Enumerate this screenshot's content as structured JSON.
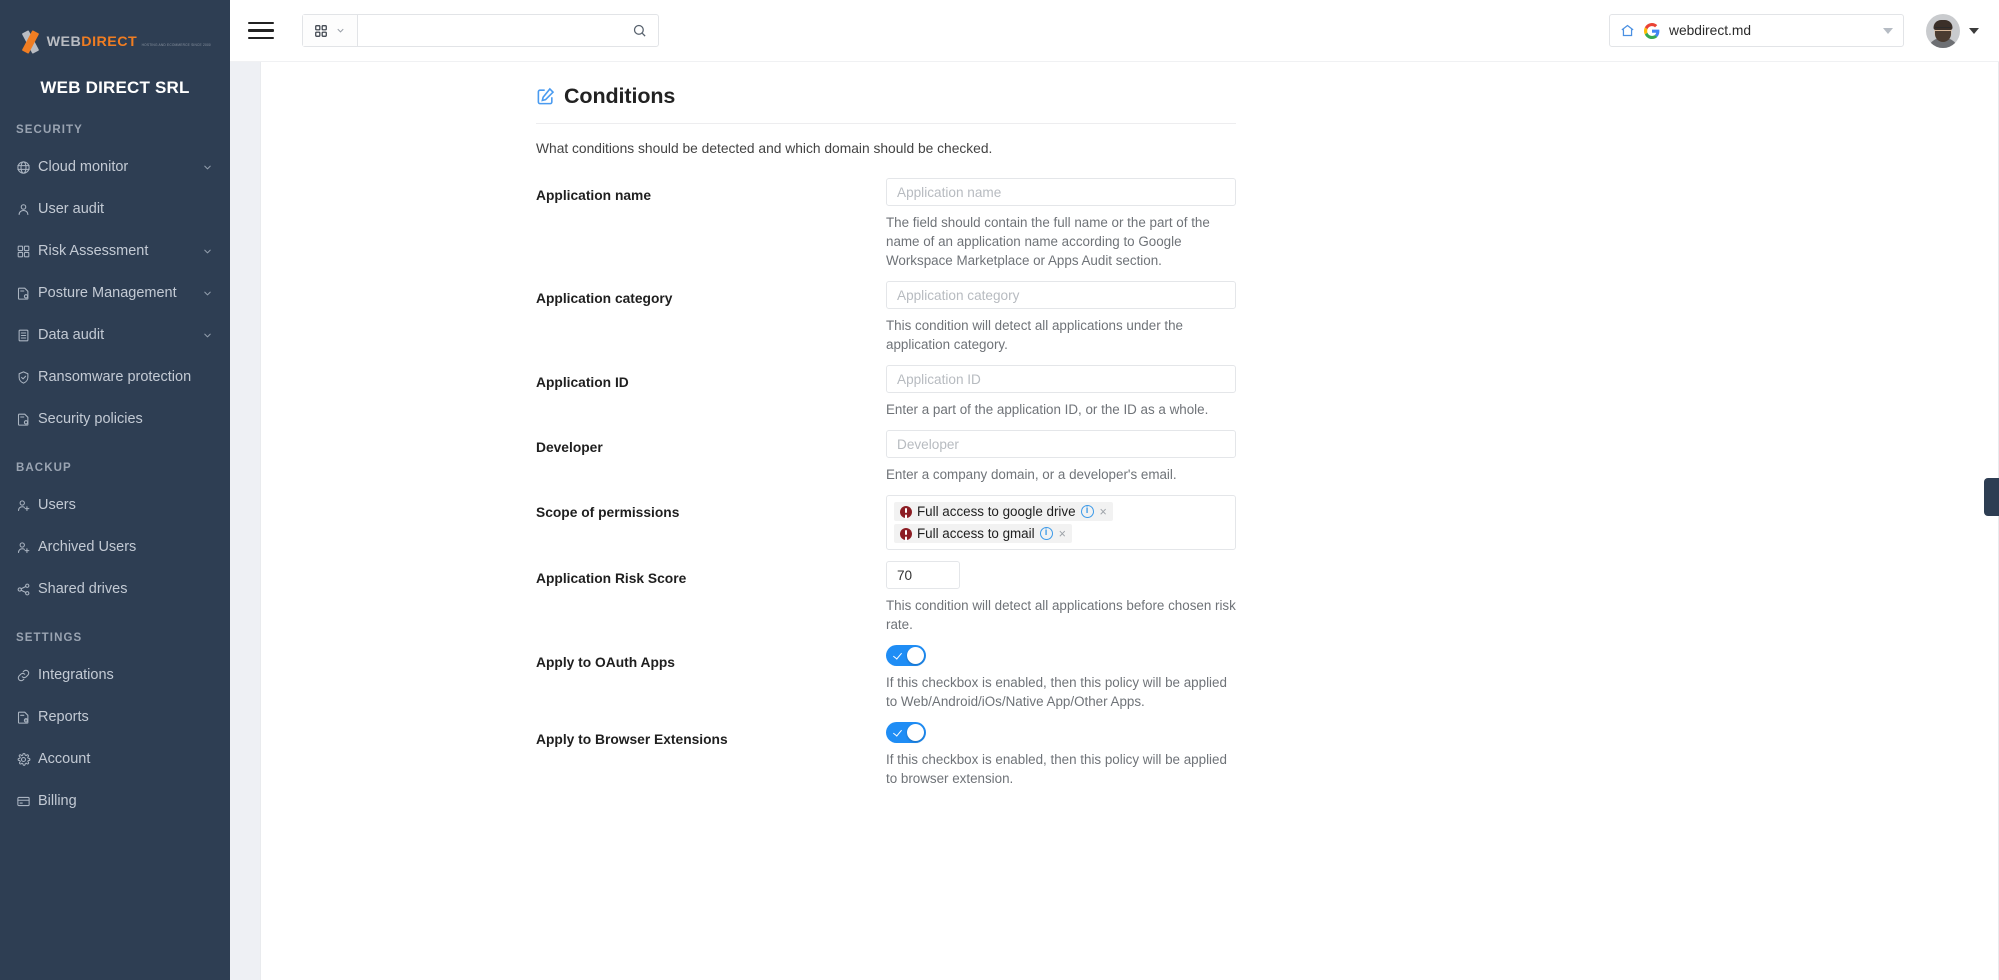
{
  "brand": {
    "logo_word_1": "WEB",
    "logo_word_2": "DIRECT",
    "logo_tagline": "HOSTING AND ECOMMERCE SINCE 2000",
    "org_name": "WEB DIRECT SRL"
  },
  "sidebar": {
    "groups": [
      {
        "title": "SECURITY",
        "items": [
          {
            "label": "Cloud monitor",
            "icon": "globe-icon",
            "chevron": true
          },
          {
            "label": "User audit",
            "icon": "user-icon",
            "chevron": false
          },
          {
            "label": "Risk Assessment",
            "icon": "grid-icon",
            "chevron": true
          },
          {
            "label": "Posture Management",
            "icon": "document-gear-icon",
            "chevron": true
          },
          {
            "label": "Data audit",
            "icon": "list-document-icon",
            "chevron": true
          },
          {
            "label": "Ransomware protection",
            "icon": "shield-check-icon",
            "chevron": false
          },
          {
            "label": "Security policies",
            "icon": "document-gear-icon",
            "chevron": false
          }
        ]
      },
      {
        "title": "BACKUP",
        "items": [
          {
            "label": "Users",
            "icon": "user-add-icon",
            "chevron": false
          },
          {
            "label": "Archived Users",
            "icon": "user-add-icon",
            "chevron": false
          },
          {
            "label": "Shared drives",
            "icon": "share-nodes-icon",
            "chevron": false
          }
        ]
      },
      {
        "title": "SETTINGS",
        "items": [
          {
            "label": "Integrations",
            "icon": "link-icon",
            "chevron": false
          },
          {
            "label": "Reports",
            "icon": "document-clock-icon",
            "chevron": false
          },
          {
            "label": "Account",
            "icon": "gear-icon",
            "chevron": false
          },
          {
            "label": "Billing",
            "icon": "credit-card-icon",
            "chevron": false
          }
        ]
      }
    ]
  },
  "topbar": {
    "menu_icon": "hamburger-icon",
    "search": {
      "value": "",
      "placeholder": "",
      "category_icon": "grid-icon",
      "submit_icon": "search-icon"
    },
    "domain": {
      "value": "webdirect.md",
      "home_icon": "home-icon",
      "provider_icon": "google-icon"
    },
    "user": {
      "avatar_icon": "avatar",
      "caret_icon": "chevron-down-icon"
    }
  },
  "panel": {
    "icon": "edit-square-icon",
    "title": "Conditions",
    "subtitle": "What conditions should be detected and which domain should be checked."
  },
  "fields": [
    {
      "label": "Application name",
      "type": "text",
      "value": "",
      "placeholder": "Application name",
      "hint": "The field should contain the full name or the part of the name of an application name according to Google Workspace Marketplace or Apps Audit section."
    },
    {
      "label": "Application category",
      "type": "text",
      "value": "",
      "placeholder": "Application category",
      "hint": "This condition will detect all applications under the application category."
    },
    {
      "label": "Application ID",
      "type": "text",
      "value": "",
      "placeholder": "Application ID",
      "hint": "Enter a part of the application ID, or the ID as a whole."
    },
    {
      "label": "Developer",
      "type": "text",
      "value": "",
      "placeholder": "Developer",
      "hint": "Enter a company domain, or a developer's email."
    },
    {
      "label": "Scope of permissions",
      "type": "chips",
      "chips": [
        {
          "text": "Full access to google drive",
          "severity": "critical",
          "info_icon": "info-icon",
          "remove_icon": "close-icon"
        },
        {
          "text": "Full access to gmail",
          "severity": "critical",
          "info_icon": "info-icon",
          "remove_icon": "close-icon"
        }
      ],
      "hint": ""
    },
    {
      "label": "Application Risk Score",
      "type": "number",
      "value": "70",
      "placeholder": "",
      "hint": "This condition will detect all applications before chosen risk rate."
    },
    {
      "label": "Apply to OAuth Apps",
      "type": "toggle",
      "value": "on",
      "hint": "If this checkbox is enabled, then this policy will be applied to Web/Android/iOs/Native App/Other Apps."
    },
    {
      "label": "Apply to Browser Extensions",
      "type": "toggle",
      "value": "on",
      "hint": "If this checkbox is enabled, then this policy will be applied to browser extension."
    }
  ],
  "colors": {
    "sidebar_bg": "#2e3e53",
    "accent_orange": "#f07d22",
    "toggle_on": "#1f8df5",
    "critical_red": "#8c1d24",
    "info_blue": "#3d9ae8"
  }
}
